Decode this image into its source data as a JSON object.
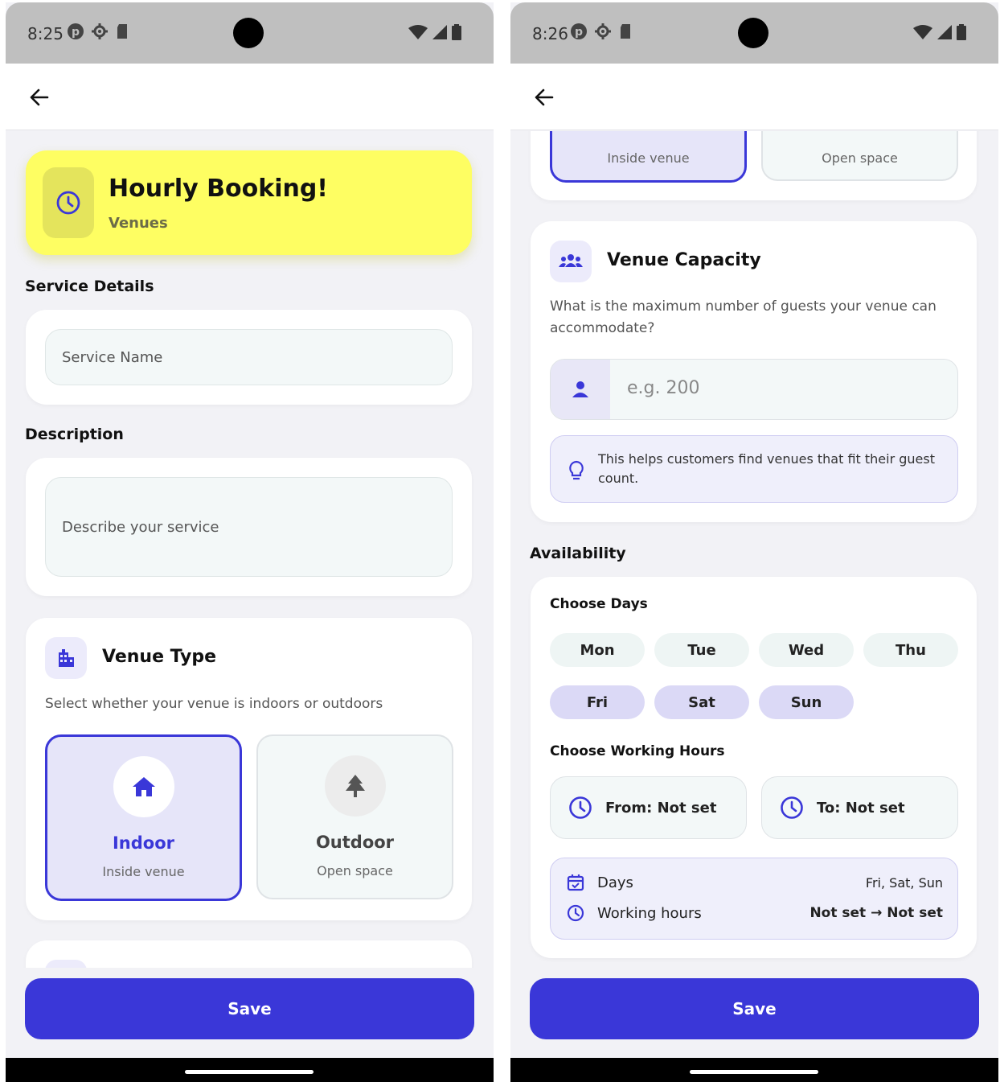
{
  "left_screen": {
    "status": {
      "time": "8:25"
    },
    "hero": {
      "title": "Hourly Booking!",
      "subtitle": "Venues"
    },
    "service_details": {
      "heading": "Service Details",
      "name_placeholder": "Service Name"
    },
    "description": {
      "heading": "Description",
      "placeholder": "Describe your service"
    },
    "venue_type": {
      "heading": "Venue Type",
      "desc": "Select whether your venue is indoors or outdoors",
      "options": [
        {
          "title": "Indoor",
          "subtitle": "Inside venue",
          "selected": true,
          "icon": "home-icon"
        },
        {
          "title": "Outdoor",
          "subtitle": "Open space",
          "selected": false,
          "icon": "tree-icon"
        }
      ]
    },
    "save_label": "Save"
  },
  "right_screen": {
    "status": {
      "time": "8:26"
    },
    "venue_type_tail": {
      "option1_sub": "Inside venue",
      "option2_sub": "Open space"
    },
    "capacity": {
      "heading": "Venue Capacity",
      "desc": "What is the maximum number of guests your venue can accommodate?",
      "placeholder": "e.g. 200",
      "tip": "This helps customers find venues that fit their guest count."
    },
    "availability": {
      "heading": "Availability",
      "choose_days": "Choose Days",
      "days": [
        {
          "label": "Mon",
          "selected": false
        },
        {
          "label": "Tue",
          "selected": false
        },
        {
          "label": "Wed",
          "selected": false
        },
        {
          "label": "Thu",
          "selected": false
        },
        {
          "label": "Fri",
          "selected": true
        },
        {
          "label": "Sat",
          "selected": true
        },
        {
          "label": "Sun",
          "selected": true
        }
      ],
      "choose_hours": "Choose Working Hours",
      "from_label": "From: Not set",
      "to_label": "To: Not set",
      "summary": {
        "days_label": "Days",
        "days_value": "Fri, Sat, Sun",
        "hours_label": "Working hours",
        "hours_value": "Not set → Not set"
      }
    },
    "save_label": "Save"
  },
  "colors": {
    "primary": "#3a37d8",
    "hero_yellow": "#fefe62",
    "selected_bg": "#e6e5f9",
    "day_selected": "#dbd9f6"
  }
}
